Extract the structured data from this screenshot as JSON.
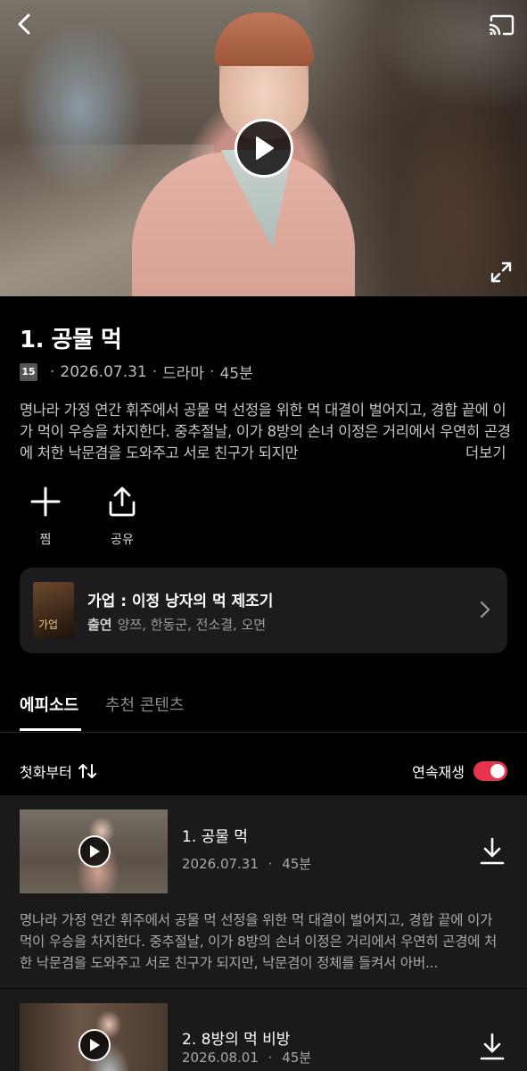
{
  "icons": {
    "back": "chevron-left-icon",
    "cast": "cast-icon",
    "fullscreen": "fullscreen-icon",
    "play": "play-icon",
    "add": "plus-icon",
    "share": "share-icon",
    "chevron": "chevron-right-icon",
    "sort": "sort-icon",
    "download": "download-icon"
  },
  "colors": {
    "accent": "#e8344a",
    "background": "#000000",
    "card": "#1c1c1e"
  },
  "episode": {
    "title": "1. 공물 먹",
    "age_rating": "15",
    "date": "2026.07.31",
    "genre": "드라마",
    "duration": "45분",
    "description": "명나라 가정 연간 휘주에서 공물 먹 선정을 위한 먹 대결이 벌어지고, 경합 끝에 이가 먹이 우승을 차지한다. 중추절날, 이가 8방의 손녀 이정은 거리에서 우연히 곤경에 처한 낙문겸을 도와주고 서로 친구가 되지만",
    "more_label": "더보기"
  },
  "actions": {
    "wishlist_label": "찜",
    "share_label": "공유"
  },
  "series": {
    "title": "가업 : 이정 낭자의 먹 제조기",
    "poster_text": "가업",
    "cast_label": "출연",
    "cast": "양쯔, 한동군, 전소결, 오면"
  },
  "tabs": [
    {
      "label": "에피소드",
      "active": true
    },
    {
      "label": "추천 콘텐츠",
      "active": false
    }
  ],
  "list_controls": {
    "sort_label": "첫화부터",
    "autoplay_label": "연속재생",
    "autoplay_on": true
  },
  "episodes": [
    {
      "name": "1. 공물 먹",
      "date": "2026.07.31",
      "duration": "45분",
      "description": "명나라 가정 연간 휘주에서 공물 먹 선정을 위한 먹 대결이 벌어지고, 경합 끝에 이가 먹이 우승을 차지한다. 중추절날, 이가 8방의 손녀 이정은 거리에서 우연히 곤경에 처한 낙문겸을 도와주고 서로 친구가 되지만, 낙문겸이 정체를 들켜서 아버..."
    },
    {
      "name": "2. 8방의 먹 비방",
      "date": "2026.08.01",
      "duration": "45분"
    }
  ],
  "separator": "·"
}
